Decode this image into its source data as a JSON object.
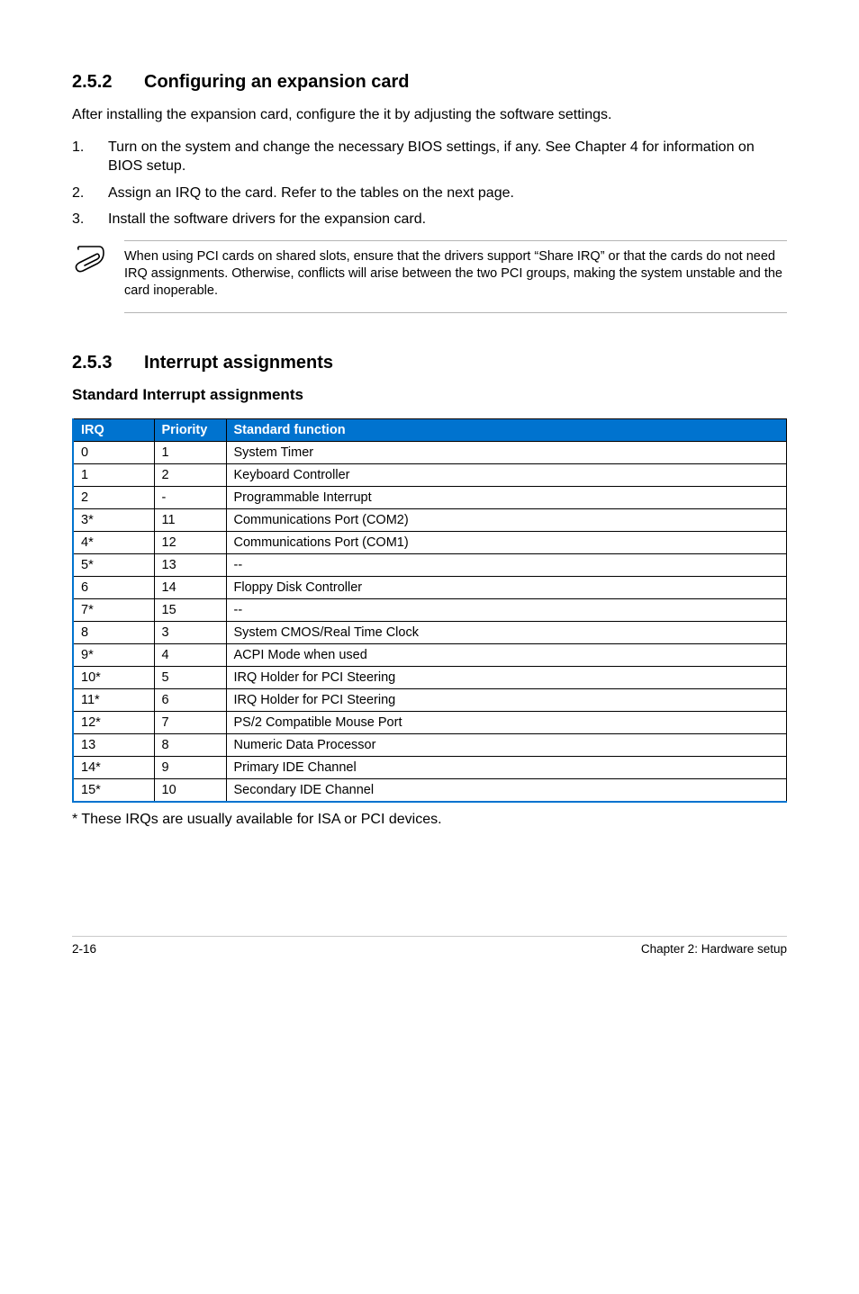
{
  "section_252": {
    "number": "2.5.2",
    "title": "Configuring an expansion card",
    "intro": "After installing the expansion card, configure the it by adjusting the software settings.",
    "steps": [
      {
        "num": "1.",
        "text": "Turn on the system and change the necessary BIOS settings, if any. See Chapter 4 for information on BIOS setup."
      },
      {
        "num": "2.",
        "text": "Assign an IRQ to the card. Refer to the tables on the next page."
      },
      {
        "num": "3.",
        "text": "Install the software drivers for the expansion card."
      }
    ],
    "note": "When using PCI cards on shared slots, ensure that the drivers support “Share IRQ” or that the cards do not need IRQ assignments. Otherwise, conflicts will arise between the two PCI groups, making the system unstable and the card inoperable."
  },
  "section_253": {
    "number": "2.5.3",
    "title": "Interrupt assignments",
    "subheading": "Standard Interrupt assignments",
    "table_headers": {
      "irq": "IRQ",
      "priority": "Priority",
      "func": "Standard function"
    },
    "rows": [
      {
        "irq": "0",
        "priority": "1",
        "func": "System Timer"
      },
      {
        "irq": "1",
        "priority": "2",
        "func": "Keyboard Controller"
      },
      {
        "irq": "2",
        "priority": "-",
        "func": "Programmable Interrupt"
      },
      {
        "irq": "3*",
        "priority": "11",
        "func": "Communications Port (COM2)"
      },
      {
        "irq": "4*",
        "priority": "12",
        "func": "Communications Port (COM1)"
      },
      {
        "irq": "5*",
        "priority": "13",
        "func": "--"
      },
      {
        "irq": "6",
        "priority": "14",
        "func": "Floppy Disk Controller"
      },
      {
        "irq": "7*",
        "priority": "15",
        "func": "--"
      },
      {
        "irq": "8",
        "priority": "3",
        "func": "System CMOS/Real Time Clock"
      },
      {
        "irq": "9*",
        "priority": "4",
        "func": "ACPI Mode when used"
      },
      {
        "irq": "10*",
        "priority": "5",
        "func": "IRQ Holder for PCI Steering"
      },
      {
        "irq": "11*",
        "priority": "6",
        "func": "IRQ Holder for PCI Steering"
      },
      {
        "irq": "12*",
        "priority": "7",
        "func": "PS/2 Compatible Mouse Port"
      },
      {
        "irq": "13",
        "priority": "8",
        "func": "Numeric Data Processor"
      },
      {
        "irq": "14*",
        "priority": "9",
        "func": "Primary IDE Channel"
      },
      {
        "irq": "15*",
        "priority": "10",
        "func": "Secondary IDE Channel"
      }
    ],
    "footnote": "* These IRQs are usually available for ISA or PCI devices."
  },
  "footer": {
    "left": "2-16",
    "right": "Chapter 2:  Hardware setup"
  }
}
